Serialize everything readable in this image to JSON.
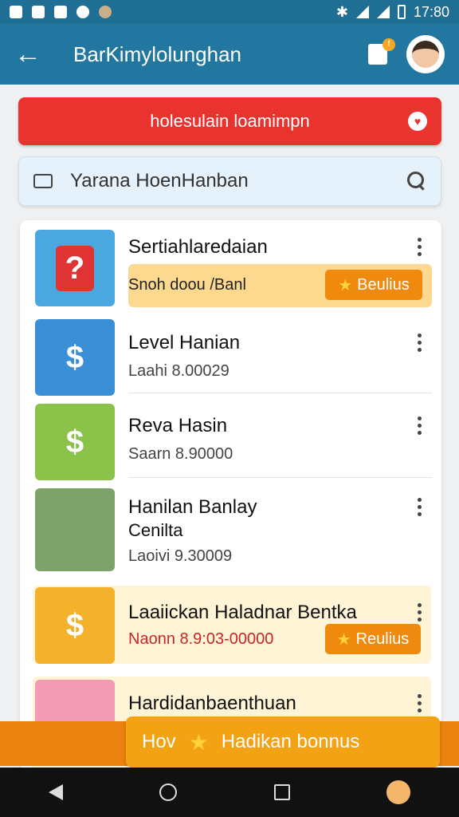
{
  "status_bar": {
    "time": "17:80",
    "icons": [
      "app-icon",
      "mail-icon",
      "photo-icon",
      "vpn-icon",
      "settings-icon",
      "bluetooth-icon",
      "wifi-icon",
      "signal-icon",
      "battery-icon"
    ]
  },
  "app_bar": {
    "title": "BarKimylolunghan",
    "cart_badge": "f"
  },
  "promo": {
    "label": "holesulain loamimpn"
  },
  "search": {
    "placeholder": "Yarana HoenHanban"
  },
  "items": [
    {
      "name": "Sertiahlaredaian",
      "status_text": "Snoh doou /Banl",
      "button_label": "Beulius"
    },
    {
      "name": "Level Hanian",
      "sub": "Laahi  8.00029"
    },
    {
      "name": "Reva Hasin",
      "sub": "Saarn  8.90000"
    },
    {
      "name_line1": "Hanilan Banlay",
      "name_line2": "Cenilta",
      "sub": "Laoivi  9.30009"
    },
    {
      "name": "Laaiickan Haladnar Bentka",
      "sub": "Naonn  8.9:03-00000",
      "button_label": "Reulius"
    },
    {
      "name": "Hardidanbaenthuan"
    }
  ],
  "bottom_cta": {
    "prefix": "Hov",
    "label": "Hadikan bonnus"
  },
  "colors": {
    "app_bar": "#2277a1",
    "promo": "#e8332f",
    "accent_orange": "#ef8a0e",
    "highlight": "#fcd98f"
  }
}
